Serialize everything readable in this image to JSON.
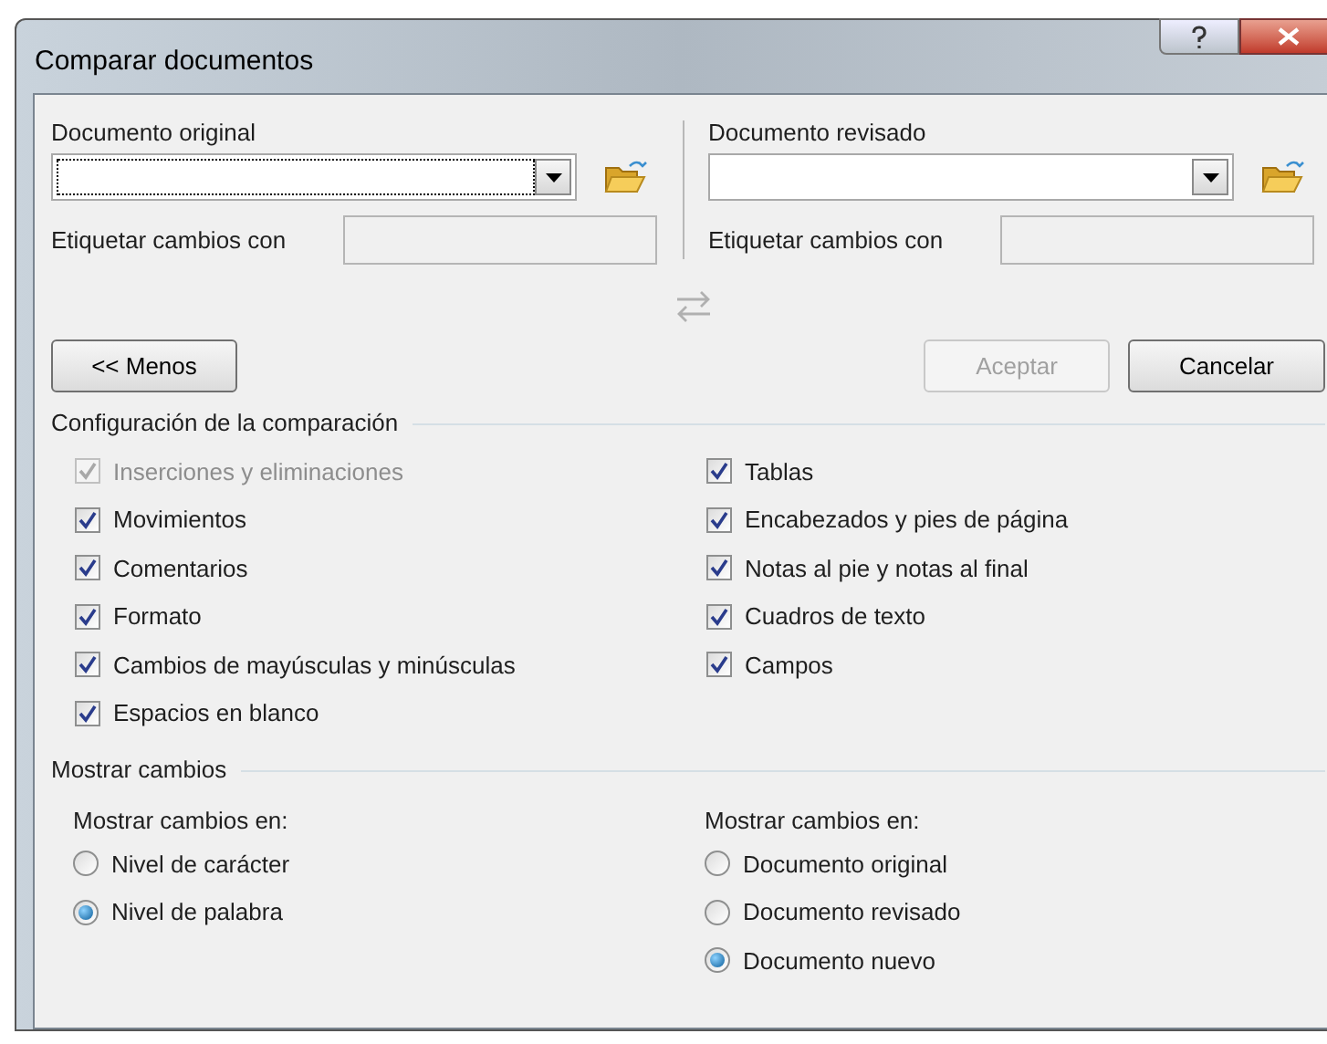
{
  "window": {
    "title": "Comparar documentos"
  },
  "original": {
    "label": "Documento original",
    "tag_label": "Etiquetar cambios con"
  },
  "revised": {
    "label": "Documento revisado",
    "tag_label": "Etiquetar cambios con"
  },
  "buttons": [
    {
      "label": "<< Menos",
      "disabled": false
    },
    {
      "label": "Aceptar",
      "disabled": true
    },
    {
      "label": "Cancelar",
      "disabled": false
    }
  ],
  "comparison_settings": {
    "title": "Configuración de la comparación",
    "left": [
      {
        "label": "Inserciones y eliminaciones",
        "checked": true,
        "disabled": true
      },
      {
        "label": "Movimientos",
        "checked": true,
        "disabled": false
      },
      {
        "label": "Comentarios",
        "checked": true,
        "disabled": false
      },
      {
        "label": "Formato",
        "checked": true,
        "disabled": false
      },
      {
        "label": "Cambios de mayúsculas y minúsculas",
        "checked": true,
        "disabled": false
      },
      {
        "label": "Espacios en blanco",
        "checked": true,
        "disabled": false
      }
    ],
    "right": [
      {
        "label": "Tablas",
        "checked": true,
        "disabled": false
      },
      {
        "label": "Encabezados y pies de página",
        "checked": true,
        "disabled": false
      },
      {
        "label": "Notas al pie y notas al final",
        "checked": true,
        "disabled": false
      },
      {
        "label": "Cuadros de texto",
        "checked": true,
        "disabled": false
      },
      {
        "label": "Campos",
        "checked": true,
        "disabled": false
      }
    ]
  },
  "show_changes": {
    "title": "Mostrar cambios",
    "groups": [
      {
        "label": "Mostrar cambios en:",
        "options": [
          {
            "label": "Nivel de carácter",
            "selected": false
          },
          {
            "label": "Nivel de palabra",
            "selected": true
          }
        ]
      },
      {
        "label": "Mostrar cambios en:",
        "options": [
          {
            "label": "Documento original",
            "selected": false
          },
          {
            "label": "Documento revisado",
            "selected": false
          },
          {
            "label": "Documento nuevo",
            "selected": true
          }
        ]
      }
    ]
  }
}
